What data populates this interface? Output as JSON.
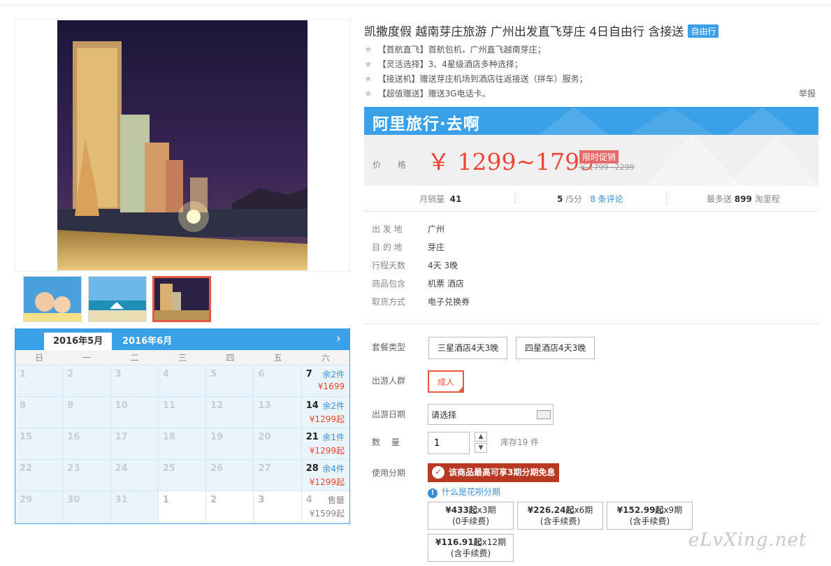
{
  "product": {
    "title": "凯撒度假 越南芽庄旅游 广州出发直飞芽庄 4日自由行 含接送",
    "badge": "自由行",
    "features": [
      "【首航直飞】首航包机，广州直飞越南芽庄；",
      "【灵活选择】3、4星级酒店多种选择；",
      "【接送机】赠送芽庄机场到酒店往返接送（拼车）服务；",
      "【超值赠送】赠送3G电话卡。"
    ],
    "report_label": "举报"
  },
  "promo": {
    "brand": "阿里旅行·去啊",
    "price_label": "价 格",
    "price_range": "￥ 1299~1799",
    "tag": "限时促销",
    "original_price": "￥ 1799~2299"
  },
  "stats": {
    "monthly_sales_label": "月销量",
    "monthly_sales": "41",
    "score": "5",
    "score_unit": "/5分",
    "reviews": "8 条评论",
    "mileage_prefix": "最多送",
    "mileage_value": "899",
    "mileage_suffix": "淘里程"
  },
  "info": [
    {
      "key": "出 发 地",
      "value": "广州"
    },
    {
      "key": "目 的 地",
      "value": "芽庄"
    },
    {
      "key": "行程天数",
      "value": "4天 3晚"
    },
    {
      "key": "商品包含",
      "value": "机票  酒店"
    },
    {
      "key": "取货方式",
      "value": "电子兑换券"
    }
  ],
  "options": {
    "package_label": "套餐类型",
    "packages": [
      "三星酒店4天3晚",
      "四星酒店4天3晚"
    ],
    "travelers_label": "出游人群",
    "traveler": "成人",
    "date_label": "出游日期",
    "date_value": "请选择",
    "qty_label": "数　 量",
    "qty_value": "1",
    "stock": "库存19 件",
    "installment_label": "使用分期",
    "huabei_banner": "该商品最高可享3期分期免息",
    "what_is": "什么是花呗分期",
    "plans": [
      {
        "amount": "¥433起",
        "term": "x3期",
        "fee": "(0手续费)"
      },
      {
        "amount": "¥226.24起",
        "term": "x6期",
        "fee": "(含手续费)"
      },
      {
        "amount": "¥152.99起",
        "term": "x9期",
        "fee": "(含手续费)"
      },
      {
        "amount": "¥116.91起",
        "term": "x12期",
        "fee": "(含手续费)"
      }
    ]
  },
  "calendar": {
    "tabs": [
      "2016年5月",
      "2016年6月"
    ],
    "weekdays": [
      "日",
      "一",
      "二",
      "三",
      "四",
      "五",
      "六"
    ],
    "rows": [
      [
        {
          "d": "1"
        },
        {
          "d": "2"
        },
        {
          "d": "3"
        },
        {
          "d": "4"
        },
        {
          "d": "5"
        },
        {
          "d": "6"
        },
        {
          "d": "7",
          "left": "余2件",
          "price": "¥1699"
        }
      ],
      [
        {
          "d": "8"
        },
        {
          "d": "9"
        },
        {
          "d": "10"
        },
        {
          "d": "11"
        },
        {
          "d": "12"
        },
        {
          "d": "13"
        },
        {
          "d": "14",
          "left": "余2件",
          "price": "¥1299起"
        }
      ],
      [
        {
          "d": "15"
        },
        {
          "d": "16"
        },
        {
          "d": "17"
        },
        {
          "d": "18"
        },
        {
          "d": "19"
        },
        {
          "d": "20"
        },
        {
          "d": "21",
          "left": "余1件",
          "price": "¥1299起"
        }
      ],
      [
        {
          "d": "22"
        },
        {
          "d": "23"
        },
        {
          "d": "24"
        },
        {
          "d": "25"
        },
        {
          "d": "26"
        },
        {
          "d": "27"
        },
        {
          "d": "28",
          "left": "余4件",
          "price": "¥1299起"
        }
      ],
      [
        {
          "d": "29"
        },
        {
          "d": "30"
        },
        {
          "d": "31"
        },
        {
          "d": "1",
          "white": true
        },
        {
          "d": "2",
          "white": true
        },
        {
          "d": "3",
          "white": true
        },
        {
          "d": "4",
          "white": true,
          "left": "售罄",
          "price": "¥1599起",
          "sold": true
        }
      ]
    ]
  },
  "watermark": "eLvXing.net",
  "colors": {
    "accent": "#3aa0e7",
    "price": "#e43333",
    "selected": "#e4593f",
    "huabei": "#b83822"
  }
}
